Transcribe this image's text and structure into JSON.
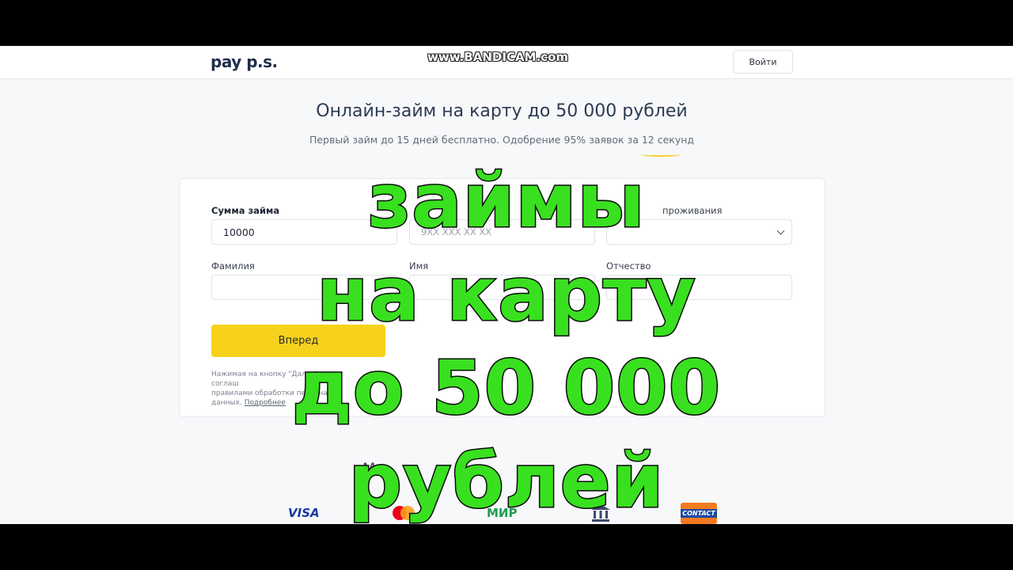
{
  "header": {
    "logo": "pay p.s.",
    "watermark": "www.BANDICAM.com",
    "login_label": "Войти"
  },
  "hero": {
    "title": "Онлайн-займ на карту до 50 000 рублей",
    "subtitle": "Первый займ до 15 дней бесплатно. Одобрение 95% заявок за 12 секунд"
  },
  "form": {
    "amount_label": "Сумма займа",
    "amount_value": "10000",
    "phone_placeholder": "9XX XXX XX XX",
    "region_label": "проживания",
    "surname_label": "Фамилия",
    "name_label": "Имя",
    "patronymic_label": "Отчество",
    "submit_label": "Вперед",
    "legal_line1": "Нажимая на кнопку \"Далее\", я соглаш",
    "legal_line2": "правилами обработки персональн",
    "legal_line3": "данных.",
    "legal_link": "Подробнее"
  },
  "payments": {
    "title_start": "М",
    "title_end": "е",
    "logos": [
      "VISA",
      "МИР",
      "CONTACT"
    ]
  },
  "overlay": {
    "line1": "займы",
    "line2": "на карту",
    "line3": "до 50 000",
    "line4": "рублей"
  },
  "colors": {
    "accent_yellow": "#f7d21d",
    "overlay_green": "#39e01f",
    "brand_navy": "#1f2d4a"
  }
}
